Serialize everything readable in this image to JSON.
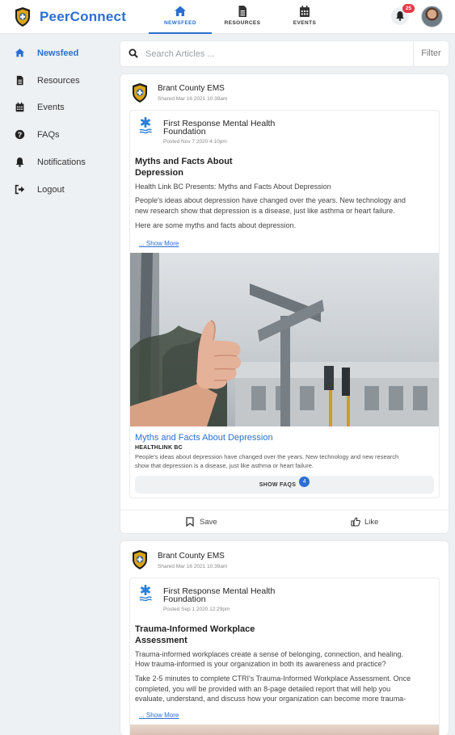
{
  "app": {
    "brand": "PeerConnect",
    "accent": "#2a6fd1",
    "badge_color": "#e53946"
  },
  "topnav": {
    "tabs": [
      {
        "label": "NEWSFEED",
        "icon": "home-icon",
        "active": true
      },
      {
        "label": "RESOURCES",
        "icon": "document-icon",
        "active": false
      },
      {
        "label": "EVENTS",
        "icon": "calendar-icon",
        "active": false
      }
    ],
    "notification_count": "25"
  },
  "sidebar": {
    "items": [
      {
        "label": "Newsfeed",
        "icon": "home-icon",
        "active": true
      },
      {
        "label": "Resources",
        "icon": "document-icon",
        "active": false
      },
      {
        "label": "Events",
        "icon": "calendar-icon",
        "active": false
      },
      {
        "label": "FAQs",
        "icon": "question-circle-icon",
        "active": false
      },
      {
        "label": "Notifications",
        "icon": "bell-icon",
        "active": false
      },
      {
        "label": "Logout",
        "icon": "logout-icon",
        "active": false
      }
    ]
  },
  "search": {
    "placeholder": "Search Articles ...",
    "filter_label": "Filter"
  },
  "posts": [
    {
      "author": "Brant County EMS",
      "shared": "Shared Mar 16 2021 10:39am",
      "org_line1": "First Response Mental Health",
      "org_line2": "Foundation",
      "posted": "Posted Nov 7 2020 4:10pm",
      "title_line1": "Myths and Facts About",
      "title_line2": "Depression",
      "body": [
        "Health Link BC Presents: Myths and Facts About Depression",
        "People's ideas about depression have changed over the years. New technology and",
        "new research show that depression is a disease, just like asthma or heart failure.",
        "Here are some myths and facts about depression."
      ],
      "show_more": "... Show More",
      "link_title": "Myths and Facts About Depression",
      "link_source": "HEALTHLINK BC",
      "link_desc": [
        "People's ideas about depression have changed over the years. New technology and new research",
        "show that depression is a disease, just like asthma or heart failure."
      ],
      "faq_label": "SHOW FAQS",
      "faq_count": "4",
      "save_label": "Save",
      "like_label": "Like"
    },
    {
      "author": "Brant County EMS",
      "shared": "Shared Mar 16 2021 10:39am",
      "org_line1": "First Response Mental Health",
      "org_line2": "Foundation",
      "posted": "Posted Sep 1 2020 12:29pm",
      "title_line1": "Trauma-Informed Workplace",
      "title_line2": "Assessment",
      "body": [
        "Trauma-informed workplaces create a sense of belonging, connection, and healing.",
        "How trauma-informed is your organization in both its awareness and practice?",
        "Take 2-5 minutes to complete CTRI's Trauma-Informed Workplace Assessment. Once",
        "completed, you will be provided with an 8-page detailed report that will help you",
        "evaluate, understand, and discuss how your organization can become more trauma-"
      ],
      "show_more": "... Show More"
    }
  ]
}
